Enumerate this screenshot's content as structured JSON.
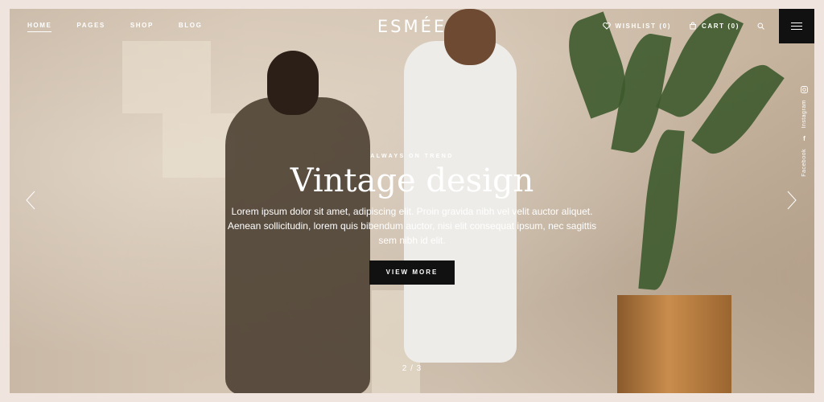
{
  "header": {
    "nav": [
      "HOME",
      "PAGES",
      "SHOP",
      "BLOG"
    ],
    "logo": "ESMÉE",
    "wishlist_label": "WISHLIST (0)",
    "cart_label": "CART (0)"
  },
  "social": {
    "instagram": "Instagram",
    "facebook": "Facebook"
  },
  "hero": {
    "eyebrow": "ALWAYS ON TREND",
    "title": "Vintage design",
    "text": "Lorem ipsum dolor sit amet, adipiscing elit. Proin gravida nibh vel velit auctor aliquet. Aenean sollicitudin, lorem quis bibendum auctor, nisi elit consequat ipsum, nec sagittis sem nibh id elit.",
    "cta": "VIEW MORE"
  },
  "slider": {
    "counter": "2 / 3"
  },
  "colors": {
    "page_bg": "#efe4de",
    "button_bg": "#111111",
    "text": "#ffffff"
  },
  "icons": [
    "heart-icon",
    "bag-icon",
    "search-icon",
    "hamburger-icon",
    "instagram-icon",
    "facebook-icon",
    "chevron-left-icon",
    "chevron-right-icon"
  ]
}
